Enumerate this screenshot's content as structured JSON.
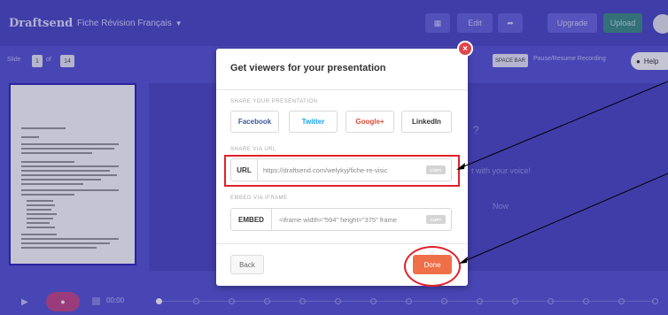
{
  "topbar": {
    "logo": "Draftsend",
    "doc_title": "Fiche Révision Français",
    "edit_label": "Edit",
    "upgrade_label": "Upgrade",
    "upload_label": "Upload"
  },
  "subbar": {
    "slide_label": "Slide",
    "slide_number": "1",
    "of_label": "of",
    "slide_total": "14",
    "space_bar_label": "SPACE BAR",
    "pause_resume_label": "Pause/Resume Recording",
    "help_label": "Help"
  },
  "stage": {
    "question_fragment": "?",
    "voice_fragment": "t with your voice!",
    "now_fragment": "Now"
  },
  "timeline": {
    "time": "00:00"
  },
  "modal": {
    "title": "Get viewers for your presentation",
    "share_section_label": "SHARE YOUR PRESENTATION",
    "share_buttons": [
      "Facebook",
      "Twitter",
      "Google+",
      "LinkedIn"
    ],
    "url_section_label": "SHARE VIA URL",
    "url_tag": "URL",
    "url_value": "https://draftsend.com/welykyj/fiche-re-visic",
    "embed_section_label": "EMBED VIA IFRAME",
    "embed_tag": "EMBED",
    "embed_value": "<iframe width=\"594\" height=\"375\" frame",
    "copy_label": "COPY",
    "back_label": "Back",
    "done_label": "Done"
  },
  "colors": {
    "accent": "#5a57d6",
    "done_button": "#ef7048",
    "annotation": "#e0212b"
  }
}
